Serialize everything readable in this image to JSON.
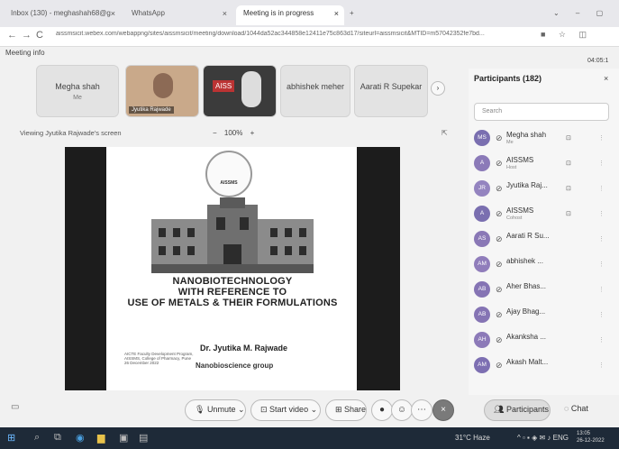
{
  "browser": {
    "tabs": [
      "Inbox (130) - meghashah68@g",
      "WhatsApp",
      "Meeting is in progress"
    ],
    "url": "aissmsicit.webex.com/webappng/sites/aissmsicit/meeting/download/1044da52ac344858e12411e75c863d17/siteurl=aissmsicit&MTID=m57042352fe7bd...",
    "back": "←",
    "forward": "→",
    "reload": "C"
  },
  "meeting": {
    "info_label": "Meeting info",
    "clock": "04:05:1",
    "viewing": "Viewing Jyutika Rajwade's screen",
    "zoom": "100%",
    "zoom_minus": "−",
    "zoom_plus": "+"
  },
  "video_tiles": [
    {
      "name": "Megha shah",
      "sub": "Me"
    },
    {
      "name": "Jyutika Rajwade"
    },
    {
      "name": "AISS"
    },
    {
      "name": "abhishek meher"
    },
    {
      "name": "Aarati R Supekar"
    }
  ],
  "slide": {
    "title_lines": [
      "NANOBIOTECHNOLOGY",
      "WITH REFERENCE TO",
      "USE OF METALS & THEIR FORMULATIONS"
    ],
    "author": "Dr. Jyutika M. Rajwade",
    "group": "Nanobioscience group",
    "footer": "AICTE Faculty Development Program, AISSMS, College of Pharmacy, Pune 26 December 2022",
    "logo_text": "AISSMS"
  },
  "participants": {
    "title": "Participants (182)",
    "search_placeholder": "Search",
    "list": [
      {
        "initials": "MS",
        "name": "Megha shah",
        "sub": "Me"
      },
      {
        "initials": "A",
        "name": "AISSMS",
        "sub": "Host"
      },
      {
        "initials": "JR",
        "name": "Jyutika Raj...",
        "sub": ""
      },
      {
        "initials": "A",
        "name": "AISSMS",
        "sub": "Cohost"
      },
      {
        "initials": "AS",
        "name": "Aarati R Su...",
        "sub": ""
      },
      {
        "initials": "AM",
        "name": "abhishek ...",
        "sub": ""
      },
      {
        "initials": "AB",
        "name": "Aher Bhas...",
        "sub": ""
      },
      {
        "initials": "AB",
        "name": "Ajay Bhag...",
        "sub": ""
      },
      {
        "initials": "AH",
        "name": "Akanksha ...",
        "sub": ""
      },
      {
        "initials": "AM",
        "name": "Akash Malt...",
        "sub": ""
      }
    ]
  },
  "toolbar": {
    "unmute": "Unmute",
    "start_video": "Start video",
    "share": "Share",
    "participants": "Participants",
    "chat": "Chat"
  },
  "taskbar": {
    "weather": "31°C Haze",
    "lang": "ENG",
    "time": "13:05",
    "date": "26-12-2022"
  }
}
